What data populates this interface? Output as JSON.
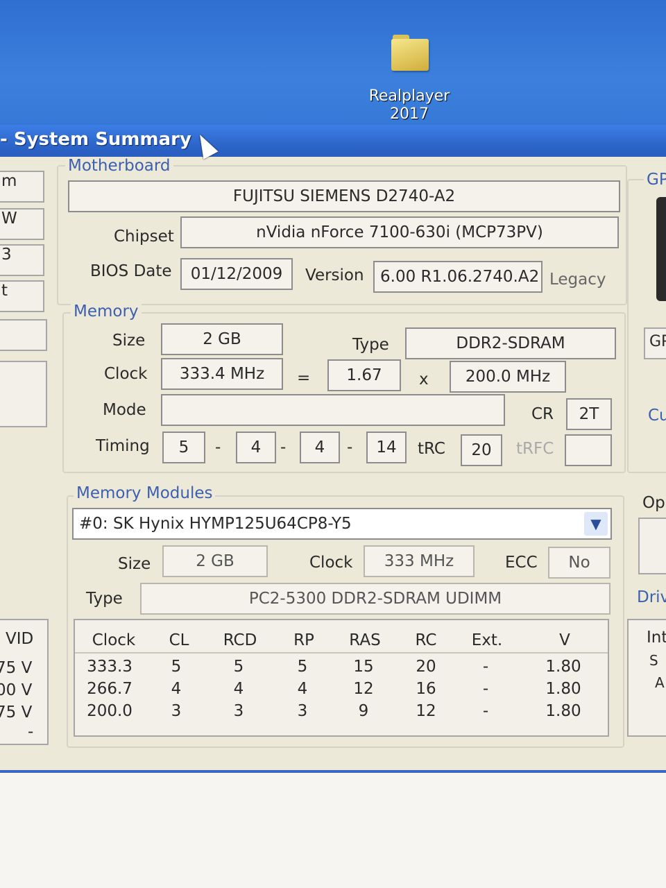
{
  "desktop": {
    "icon_label": "Realplayer 2017"
  },
  "window": {
    "title": "- System Summary"
  },
  "motherboard": {
    "legend": "Motherboard",
    "name": "FUJITSU SIEMENS D2740-A2",
    "chipset_label": "Chipset",
    "chipset": "nVidia nForce 7100-630i (MCP73PV)",
    "bios_date_label": "BIOS Date",
    "bios_date": "01/12/2009",
    "version_label": "Version",
    "version": "6.00 R1.06.2740.A2",
    "legacy": "Legacy"
  },
  "memory": {
    "legend": "Memory",
    "size_label": "Size",
    "size": "2 GB",
    "type_label": "Type",
    "type": "DDR2-SDRAM",
    "clock_label": "Clock",
    "clock": "333.4 MHz",
    "eq": "=",
    "multiplier": "1.67",
    "x": "x",
    "fsb": "200.0 MHz",
    "mode_label": "Mode",
    "mode": "",
    "cr_label": "CR",
    "cr": "2T",
    "timing_label": "Timing",
    "t1": "5",
    "t2": "4",
    "t3": "4",
    "t4": "14",
    "dash": "-",
    "trc_label": "tRC",
    "trc": "20",
    "trfc_label": "tRFC",
    "trfc": ""
  },
  "modules": {
    "legend": "Memory Modules",
    "selected": "#0: SK Hynix HYMP125U64CP8-Y5",
    "size_label": "Size",
    "size": "2 GB",
    "clock_label": "Clock",
    "clock": "333 MHz",
    "ecc_label": "ECC",
    "ecc": "No",
    "type_label": "Type",
    "type": "PC2-5300 DDR2-SDRAM UDIMM",
    "table": {
      "headers": [
        "Clock",
        "CL",
        "RCD",
        "RP",
        "RAS",
        "RC",
        "Ext.",
        "V"
      ],
      "rows": [
        [
          "333.3",
          "5",
          "5",
          "5",
          "15",
          "20",
          "-",
          "1.80"
        ],
        [
          "266.7",
          "4",
          "4",
          "4",
          "12",
          "16",
          "-",
          "1.80"
        ],
        [
          "200.0",
          "3",
          "3",
          "3",
          "9",
          "12",
          "-",
          "1.80"
        ]
      ]
    }
  },
  "left_stub": {
    "items": [
      "m",
      "W",
      "3",
      "t"
    ],
    "vid_header": "VID",
    "vid_rows": [
      "75 V",
      "00 V",
      "75 V",
      "-"
    ]
  },
  "right_stub": {
    "gp": "GP",
    "gp2": "GP",
    "cu": "Cu",
    "op": "Op",
    "driv": "Driv",
    "int": "Int",
    "s": "S",
    "a": "A"
  }
}
